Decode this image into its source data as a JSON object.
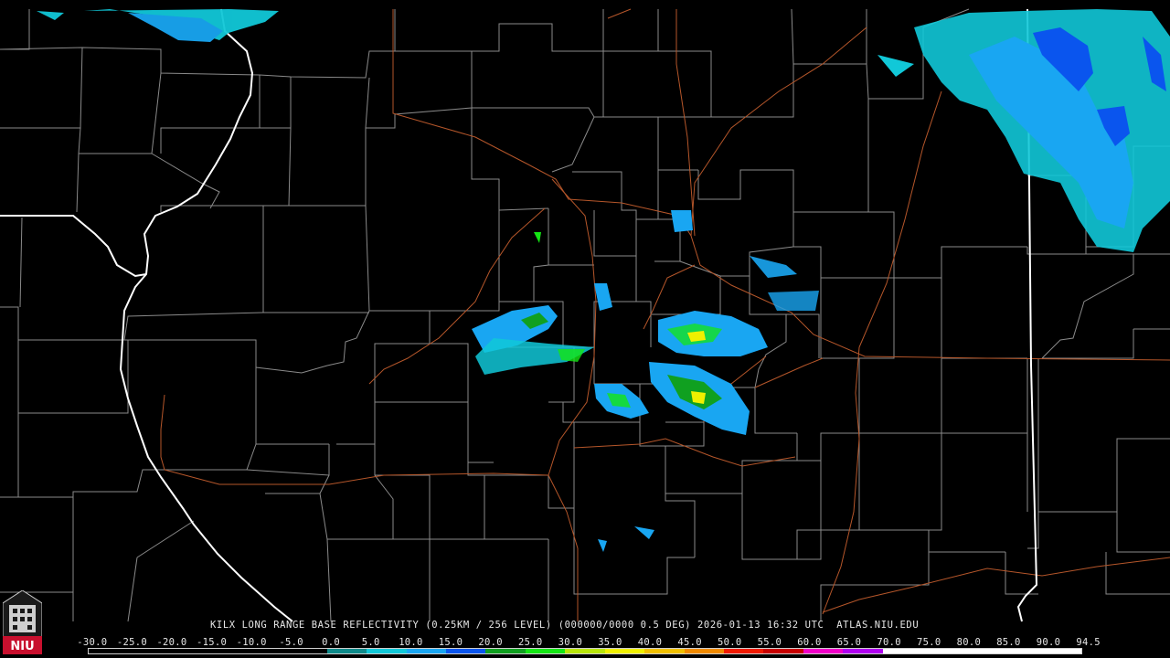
{
  "caption": {
    "station": "KILX",
    "product": "LONG RANGE BASE REFLECTIVITY",
    "resolution": "(0.25KM / 256 LEVEL)",
    "volume": "(000000/0000 0.5 DEG)",
    "timestamp": "2026-01-13 16:32 UTC",
    "source": "ATLAS.NIU.EDU"
  },
  "legend": {
    "labels": [
      "-30.0",
      "-25.0",
      "-20.0",
      "-15.0",
      "-10.0",
      "-5.0",
      "0.0",
      "5.0",
      "10.0",
      "15.0",
      "20.0",
      "25.0",
      "30.0",
      "35.0",
      "40.0",
      "45.0",
      "50.0",
      "55.0",
      "60.0",
      "65.0",
      "70.0",
      "75.0",
      "80.0",
      "85.0",
      "90.0",
      "94.5"
    ],
    "colors": [
      "#000000",
      "#000000",
      "#000000",
      "#000000",
      "#000000",
      "#000000",
      "#0f8a8a",
      "#11c8d8",
      "#19a6f2",
      "#0a55ee",
      "#10a020",
      "#14e614",
      "#b8e60a",
      "#f0f000",
      "#f0c000",
      "#f08a00",
      "#f01a00",
      "#c80000",
      "#f000c8",
      "#b000f0",
      "#ffffff",
      "#ffffff",
      "#ffffff",
      "#ffffff",
      "#ffffff"
    ]
  },
  "logo": {
    "text": "NIU",
    "background": "#c8102e"
  },
  "colors": {
    "background": "#000000",
    "county_lines": "#8a8a8a",
    "state_lines": "#ffffff",
    "highways": "#b5562a",
    "echo_light": "#19a6f2",
    "echo_teal": "#0f8a8a",
    "echo_cyan": "#11c8d8",
    "echo_blue": "#0a55ee",
    "echo_green": "#14e614",
    "echo_yellow": "#f0f000"
  }
}
